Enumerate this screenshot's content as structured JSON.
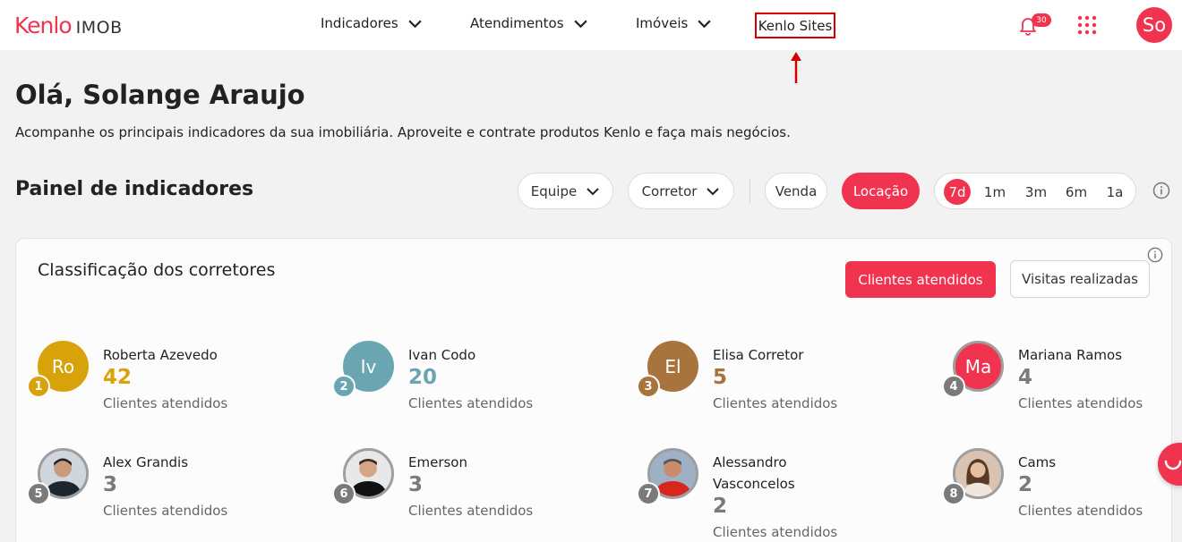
{
  "header": {
    "logo_brand": "Kenlo",
    "logo_product": "IMOB",
    "nav": [
      {
        "label": "Indicadores"
      },
      {
        "label": "Atendimentos"
      },
      {
        "label": "Imóveis"
      }
    ],
    "highlighted_link": "Kenlo Sites",
    "notifications_count": "30",
    "user_initials": "So"
  },
  "greeting": {
    "title": "Olá, Solange Araujo",
    "subtitle": "Acompanhe os principais indicadores da sua imobiliária. Aproveite e contrate produtos Kenlo e faça mais negócios."
  },
  "panel": {
    "title": "Painel de indicadores",
    "filters": {
      "team": "Equipe",
      "agent": "Corretor"
    },
    "deal_types": [
      {
        "label": "Venda",
        "active": false
      },
      {
        "label": "Locação",
        "active": true
      }
    ],
    "periods": [
      {
        "label": "7d",
        "active": true
      },
      {
        "label": "1m",
        "active": false
      },
      {
        "label": "3m",
        "active": false
      },
      {
        "label": "6m",
        "active": false
      },
      {
        "label": "1a",
        "active": false
      }
    ]
  },
  "ranking": {
    "title": "Classificação dos corretores",
    "tabs": [
      {
        "label": "Clientes atendidos",
        "active": true
      },
      {
        "label": "Visitas realizadas",
        "active": false
      }
    ],
    "entries": [
      {
        "position": "1",
        "initials": "Ro",
        "name": "Roberta Azevedo",
        "count": "42",
        "metric": "Clientes atendidos",
        "color": "#d8a30a"
      },
      {
        "position": "2",
        "initials": "Iv",
        "name": "Ivan Codo",
        "count": "20",
        "metric": "Clientes atendidos",
        "color": "#6aa6b1"
      },
      {
        "position": "3",
        "initials": "El",
        "name": "Elisa Corretor",
        "count": "5",
        "metric": "Clientes atendidos",
        "color": "#a8733c"
      },
      {
        "position": "4",
        "initials": "Ma",
        "name": "Mariana Ramos",
        "count": "4",
        "metric": "Clientes atendidos",
        "color": "#f0334e"
      },
      {
        "position": "5",
        "initials": "",
        "name": "Alex Grandis",
        "count": "3",
        "metric": "Clientes atendidos",
        "color": "#7a7a7a"
      },
      {
        "position": "6",
        "initials": "",
        "name": "Emerson",
        "count": "3",
        "metric": "Clientes atendidos",
        "color": "#7a7a7a"
      },
      {
        "position": "7",
        "initials": "",
        "name": "Alessandro Vasconcelos",
        "count": "2",
        "metric": "Clientes atendidos",
        "color": "#7a7a7a"
      },
      {
        "position": "8",
        "initials": "",
        "name": "Cams",
        "count": "2",
        "metric": "Clientes atendidos",
        "color": "#7a7a7a"
      }
    ]
  },
  "colors": {
    "brand": "#f0334e",
    "annotation": "#d40000",
    "neutral_rank": "#7a7a7a"
  },
  "icons": [
    "chevron-down-icon",
    "bell-icon",
    "apps-grid-icon",
    "info-icon",
    "annotation-arrow-icon"
  ]
}
